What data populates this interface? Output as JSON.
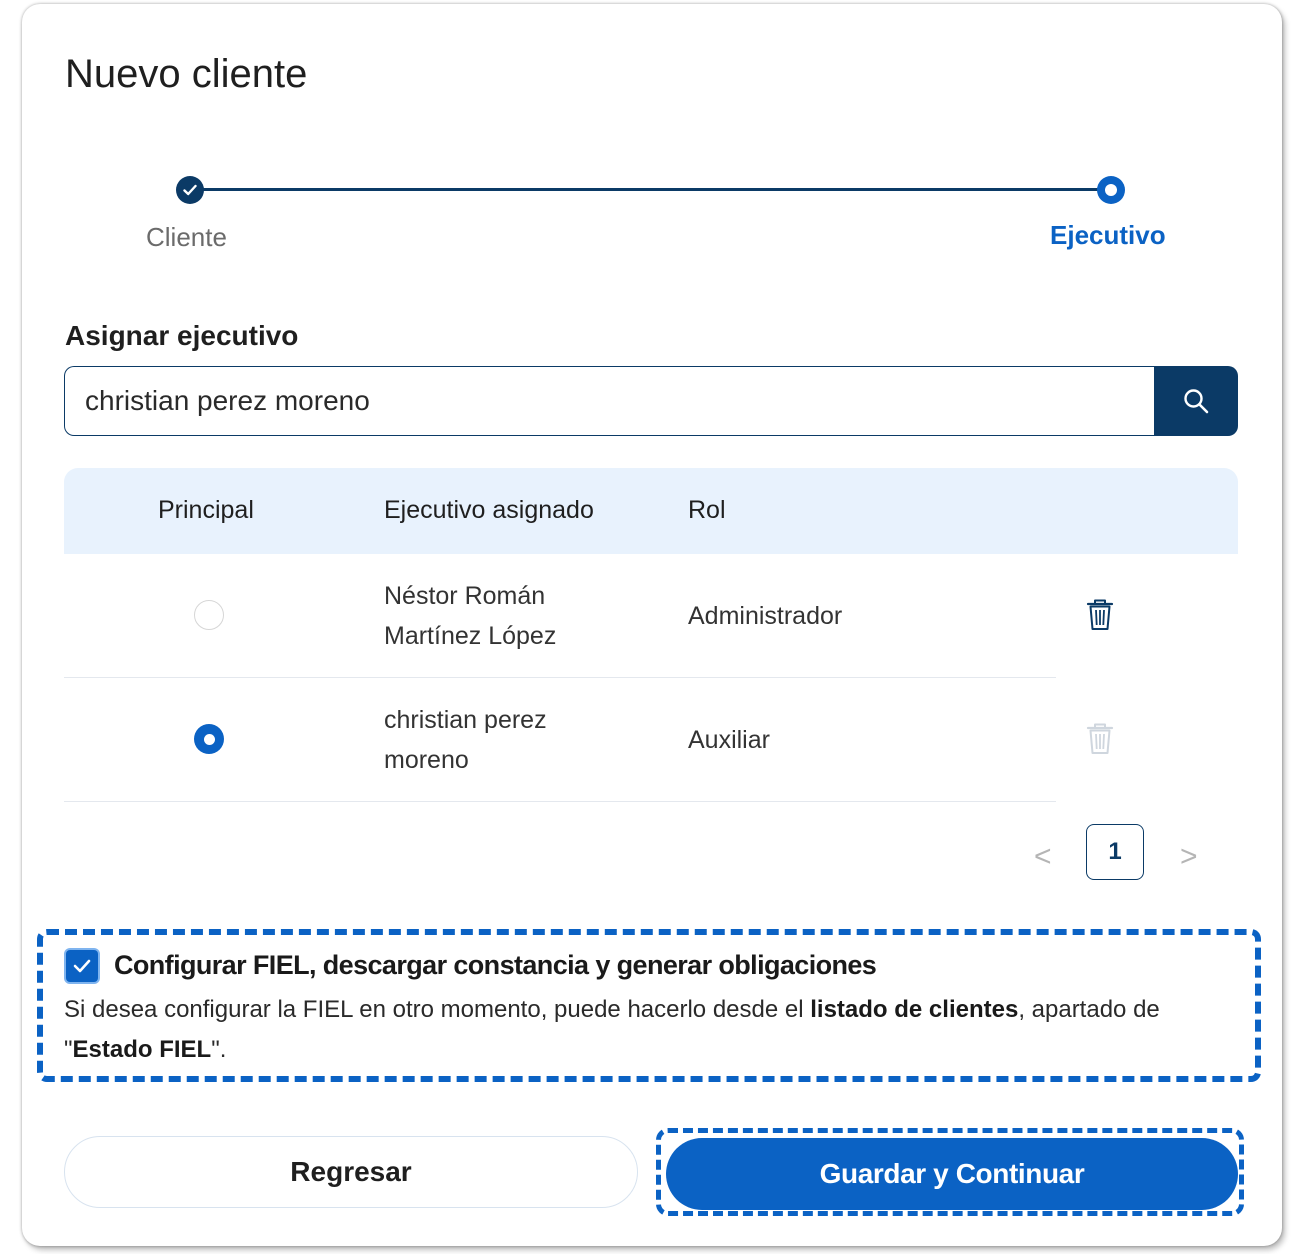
{
  "modal": {
    "title": "Nuevo cliente"
  },
  "stepper": {
    "steps": [
      {
        "label": "Cliente",
        "state": "completed"
      },
      {
        "label": "Ejecutivo",
        "state": "active"
      }
    ]
  },
  "assign": {
    "section_title": "Asignar ejecutivo",
    "search_value": "christian perez moreno"
  },
  "table": {
    "headers": [
      "Principal",
      "Ejecutivo asignado",
      "Rol"
    ],
    "rows": [
      {
        "principal": false,
        "name_line1": "Néstor Román",
        "name_line2": "Martínez López",
        "role": "Administrador",
        "delete_enabled": true
      },
      {
        "principal": true,
        "name_line1": "christian perez",
        "name_line2": "moreno",
        "role": "Auxiliar",
        "delete_enabled": false
      }
    ]
  },
  "pagination": {
    "prev": "<",
    "current_page": "1",
    "next": ">"
  },
  "fiel": {
    "checked": true,
    "title": "Configurar FIEL, descargar constancia y generar obligaciones",
    "text_part1": "Si desea configurar la FIEL en otro momento, puede hacerlo desde el ",
    "text_bold1": "listado de clientes",
    "text_part2": ", apartado de",
    "text_quote_open": "\"",
    "text_bold2": "Estado FIEL",
    "text_quote_close": "\"."
  },
  "actions": {
    "back_label": "Regresar",
    "save_label": "Guardar y Continuar"
  },
  "colors": {
    "primary": "#0b62c4",
    "navy": "#0b3a66",
    "header_bg": "#e8f2fd"
  },
  "icons": {
    "step_done": "check-icon",
    "search": "search-icon",
    "delete": "trash-icon",
    "checkbox": "check-icon"
  }
}
